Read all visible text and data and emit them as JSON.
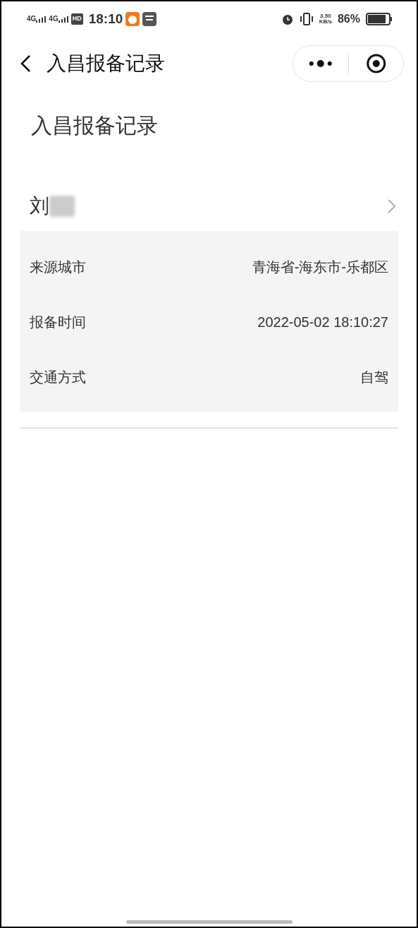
{
  "status_bar": {
    "network_1": "4G",
    "network_2": "4G",
    "hd": "HD",
    "time": "18:10",
    "speed": "3.50",
    "speed_unit": "KB/s",
    "battery": "86%"
  },
  "nav_bar": {
    "title": "入昌报备记录"
  },
  "page": {
    "heading": "入昌报备记录"
  },
  "records": [
    {
      "name": "刘",
      "expanded": true,
      "fields": [
        {
          "label": "来源城市",
          "value": "青海省-海东市-乐都区"
        },
        {
          "label": "报备时间",
          "value": "2022-05-02 18:10:27"
        },
        {
          "label": "交通方式",
          "value": "自驾"
        }
      ]
    }
  ]
}
